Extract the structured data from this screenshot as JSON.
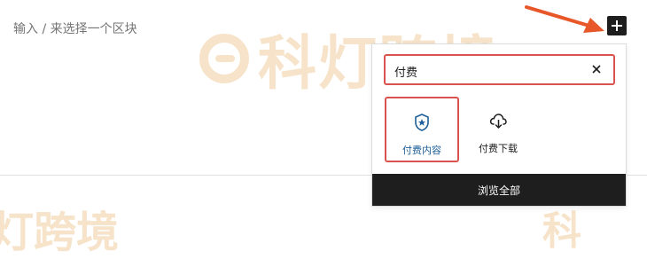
{
  "watermark": {
    "main": "科灯跨境",
    "bottom": "灯跨境",
    "right": "科"
  },
  "editor": {
    "placeholder": "输入 / 来选择一个区块"
  },
  "colors": {
    "highlight": "#d9534f",
    "arrow": "#e8572a",
    "dark": "#1e1e1e"
  },
  "inserter": {
    "search_value": "付费",
    "clear_icon": "close-icon",
    "blocks": [
      {
        "label": "付费内容",
        "icon": "shield-star-icon",
        "highlighted": true
      },
      {
        "label": "付费下载",
        "icon": "cloud-download-icon",
        "highlighted": false
      }
    ],
    "browse_all": "浏览全部"
  },
  "toolbar": {
    "add_icon": "plus-icon"
  }
}
